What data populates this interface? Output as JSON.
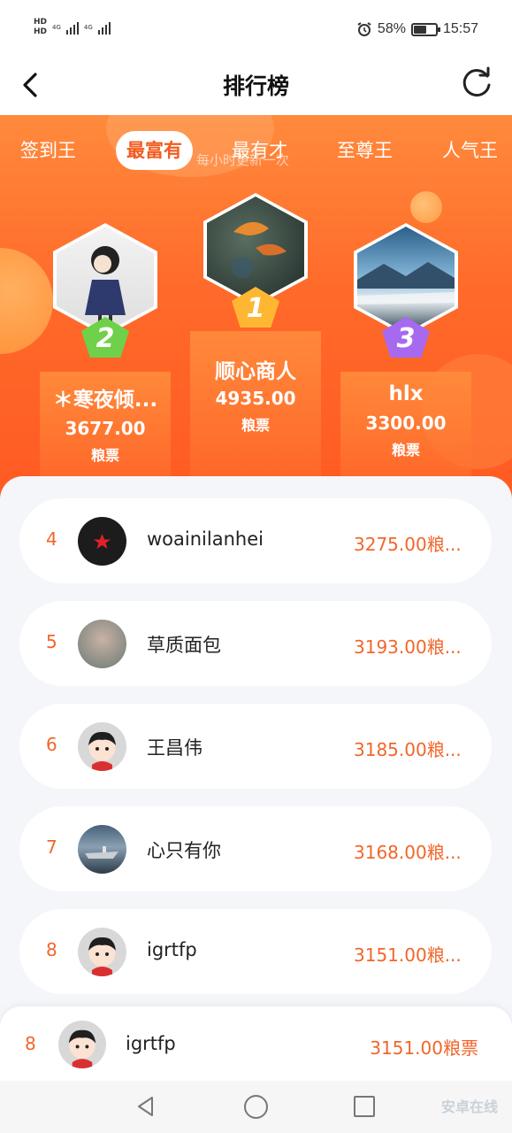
{
  "status_bar": {
    "hd1": "HD",
    "hd2": "HD",
    "net1": "4G",
    "net2": "4G",
    "battery": "58%",
    "time": "15:57"
  },
  "header": {
    "title": "排行榜",
    "back_icon": "chevron-left-icon",
    "refresh_icon": "refresh-icon"
  },
  "hero": {
    "update_note": "每小时更新一次",
    "tabs": [
      {
        "label": "签到王",
        "active": false
      },
      {
        "label": "最富有",
        "active": true
      },
      {
        "label": "最有才",
        "active": false
      },
      {
        "label": "至尊王",
        "active": false
      },
      {
        "label": "人气王",
        "active": false
      }
    ],
    "podium": [
      {
        "rank": "2",
        "name": "＊寒夜倾...",
        "value": "3677.00",
        "unit": "粮票",
        "medal_color": "#6fd04a"
      },
      {
        "rank": "1",
        "name": "顺心商人",
        "value": "4935.00",
        "unit": "粮票",
        "medal_color": "#ffb733"
      },
      {
        "rank": "3",
        "name": "hlx",
        "value": "3300.00",
        "unit": "粮票",
        "medal_color": "#a769f0"
      }
    ]
  },
  "list": [
    {
      "rank": "4",
      "name": "woainilanhei",
      "score": "3275.00粮...",
      "avatar": "star-avatar"
    },
    {
      "rank": "5",
      "name": "草质面包",
      "score": "3193.00粮...",
      "avatar": "photo-avatar"
    },
    {
      "rank": "6",
      "name": "王昌伟",
      "score": "3185.00粮...",
      "avatar": "cartoon-avatar"
    },
    {
      "rank": "7",
      "name": "心只有你",
      "score": "3168.00粮...",
      "avatar": "ship-avatar"
    },
    {
      "rank": "8",
      "name": "igrtfp",
      "score": "3151.00粮...",
      "avatar": "cartoon-avatar"
    }
  ],
  "my_rank": {
    "rank": "8",
    "name": "igrtfp",
    "score": "3151.00粮票"
  },
  "watermark": "安卓在线",
  "colors": {
    "accent": "#f2662a",
    "hero_top": "#ff8a3c",
    "hero_bottom": "#ff5a22"
  }
}
